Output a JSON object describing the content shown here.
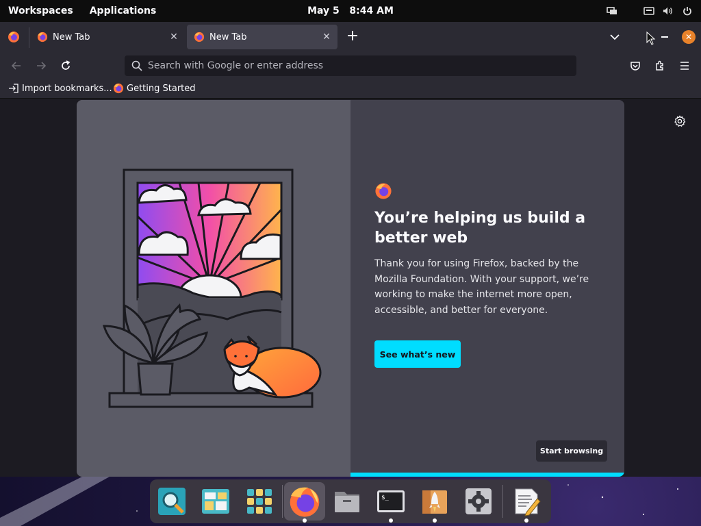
{
  "top_panel": {
    "workspaces": "Workspaces",
    "applications": "Applications",
    "date": "May 5",
    "time": "8:44 AM",
    "tray_icons": [
      "screen-share-icon",
      "keyboard-icon",
      "volume-icon",
      "power-icon"
    ]
  },
  "browser": {
    "tabs": [
      {
        "title": "New Tab",
        "active": false
      },
      {
        "title": "New Tab",
        "active": true
      }
    ],
    "new_tab_symbol": "+",
    "url_placeholder": "Search with Google or enter address",
    "bookmarks": [
      {
        "label": "Import bookmarks...",
        "icon": "import-icon"
      },
      {
        "label": "Getting Started",
        "icon": "firefox-icon"
      }
    ]
  },
  "onboarding": {
    "headline": "You’re helping us build a better web",
    "body": "Thank you for using Firefox, backed by the Mozilla Foundation. With your support, we’re working to make the internet more open, accessible, and better for everyone.",
    "primary_button": "See what’s new",
    "secondary_button": "Start browsing"
  },
  "dock": {
    "apps": [
      {
        "name": "Search",
        "icon": "search-app-icon",
        "running": false
      },
      {
        "name": "Workspaces",
        "icon": "workspaces-icon",
        "running": false
      },
      {
        "name": "Applications",
        "icon": "app-grid-icon",
        "running": false
      },
      {
        "name": "Firefox",
        "icon": "firefox-icon",
        "running": true
      },
      {
        "name": "Files",
        "icon": "files-icon",
        "running": false
      },
      {
        "name": "Terminal",
        "icon": "terminal-icon",
        "running": true
      },
      {
        "name": "Pop!_Shop",
        "icon": "shop-icon",
        "running": true
      },
      {
        "name": "Settings",
        "icon": "settings-icon",
        "running": false
      },
      {
        "name": "Text Editor",
        "icon": "text-editor-icon",
        "running": true
      }
    ],
    "terminal_prompt": "$_"
  },
  "colors": {
    "accent": "#00ddff",
    "toolbar": "#2b2a33",
    "close_button": "#e8822a"
  }
}
